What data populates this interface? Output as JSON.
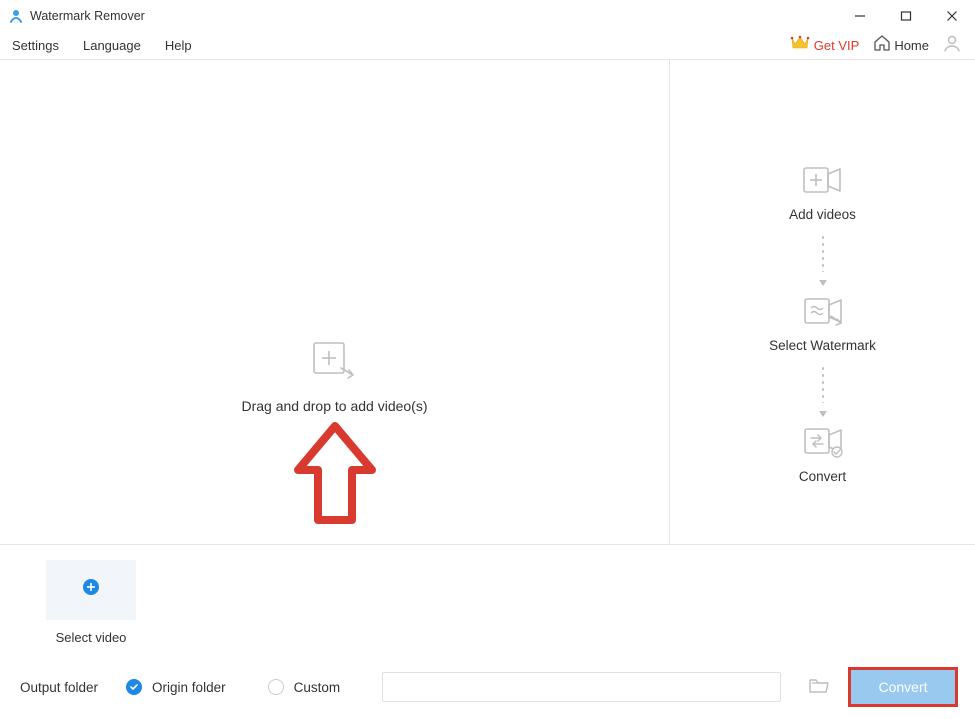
{
  "titlebar": {
    "app_title": "Watermark Remover"
  },
  "menubar": {
    "settings": "Settings",
    "language": "Language",
    "help": "Help",
    "get_vip": "Get VIP",
    "home": "Home"
  },
  "drop": {
    "label": "Drag and drop to add video(s)"
  },
  "steps": {
    "add_videos": "Add videos",
    "select_watermark": "Select Watermark",
    "convert": "Convert"
  },
  "select_strip": {
    "label": "Select video"
  },
  "output": {
    "label": "Output folder",
    "origin": "Origin folder",
    "custom": "Custom",
    "path": "",
    "convert_btn": "Convert"
  }
}
